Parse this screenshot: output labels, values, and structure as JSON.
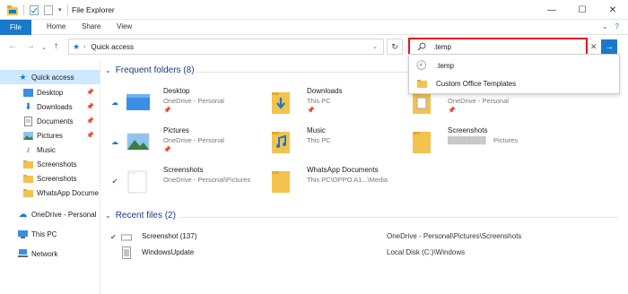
{
  "window": {
    "title": "File Explorer"
  },
  "ribbon": {
    "tabs": [
      "File",
      "Home",
      "Share",
      "View"
    ]
  },
  "address": {
    "path": "Quick access"
  },
  "search": {
    "value": ".temp"
  },
  "search_dropdown": {
    "items": [
      {
        "label": ".temp",
        "icon": "history-icon"
      },
      {
        "label": "Custom Office Templates",
        "icon": "folder-icon"
      }
    ]
  },
  "sidebar": {
    "items": [
      {
        "label": "Quick access",
        "icon": "star-icon",
        "pinned": false
      },
      {
        "label": "Desktop",
        "icon": "desktop-icon",
        "pinned": true
      },
      {
        "label": "Downloads",
        "icon": "download-icon",
        "pinned": true
      },
      {
        "label": "Documents",
        "icon": "documents-icon",
        "pinned": true
      },
      {
        "label": "Pictures",
        "icon": "pictures-icon",
        "pinned": true
      },
      {
        "label": "Music",
        "icon": "music-icon",
        "pinned": false
      },
      {
        "label": "Screenshots",
        "icon": "folder-icon",
        "pinned": false
      },
      {
        "label": "Screenshots",
        "icon": "folder-icon",
        "pinned": false
      },
      {
        "label": "WhatsApp Docume",
        "icon": "folder-icon",
        "pinned": false
      },
      {
        "label": "OneDrive - Personal",
        "icon": "onedrive-icon",
        "pinned": false
      },
      {
        "label": "This PC",
        "icon": "pc-icon",
        "pinned": false
      },
      {
        "label": "Network",
        "icon": "network-icon",
        "pinned": false
      }
    ]
  },
  "frequent": {
    "title": "Frequent folders (8)",
    "folders": [
      {
        "name": "Desktop",
        "sub": "OneDrive - Personal",
        "status": "cloud",
        "icon": "desktop-folder-icon",
        "pinned": true
      },
      {
        "name": "Downloads",
        "sub": "This PC",
        "status": "",
        "icon": "downloads-folder-icon",
        "pinned": true
      },
      {
        "name": "",
        "sub": "OneDrive - Personal",
        "status": "",
        "icon": "documents-folder-icon",
        "pinned": true
      },
      {
        "name": "Pictures",
        "sub": "OneDrive - Personal",
        "status": "cloud",
        "icon": "pictures-folder-icon",
        "pinned": true
      },
      {
        "name": "Music",
        "sub": "This PC",
        "status": "",
        "icon": "music-folder-icon",
        "pinned": false
      },
      {
        "name": "Screenshots",
        "sub": "Pictures",
        "status": "",
        "icon": "folder-icon",
        "pinned": false
      },
      {
        "name": "Screenshots",
        "sub": "OneDrive - Personal\\Pictures",
        "status": "check",
        "icon": "white-folder-icon",
        "pinned": false
      },
      {
        "name": "WhatsApp Documents",
        "sub": "This PC\\OPPO A1...\\Media",
        "status": "",
        "icon": "folder-icon",
        "pinned": false
      }
    ]
  },
  "recent": {
    "title": "Recent files (2)",
    "files": [
      {
        "name": "Screenshot (137)",
        "location": "OneDrive - Personal\\Pictures\\Screenshots",
        "status": "check"
      },
      {
        "name": "WindowsUpdate",
        "location": "Local Disk (C:)\\Windows",
        "status": ""
      }
    ]
  },
  "colors": {
    "accent": "#1979ca",
    "highlight": "#e0161c",
    "selected": "#cde8ff",
    "folder": "#f3c24f"
  }
}
